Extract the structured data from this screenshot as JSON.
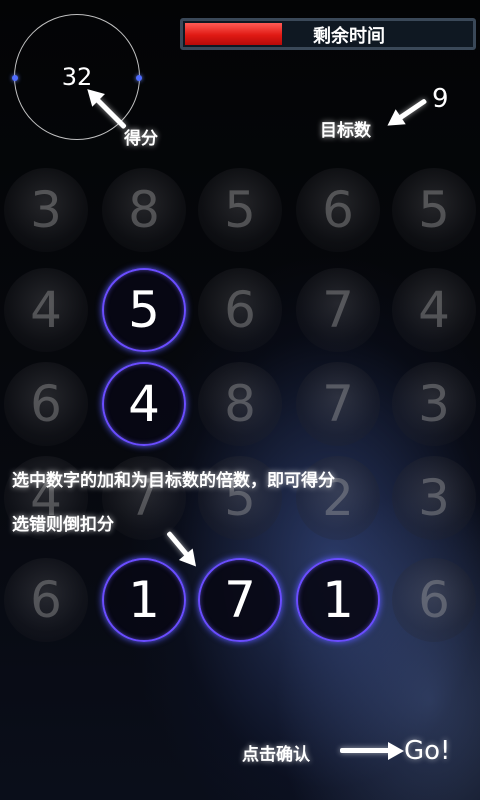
{
  "score": {
    "value": "32",
    "label": "得分"
  },
  "timer": {
    "label": "剩余时间",
    "remaining_fraction": 0.34
  },
  "target": {
    "value": "9",
    "label": "目标数"
  },
  "grid": {
    "rows": [
      [
        {
          "n": "3",
          "s": false
        },
        {
          "n": "8",
          "s": false
        },
        {
          "n": "5",
          "s": false
        },
        {
          "n": "6",
          "s": false
        },
        {
          "n": "5",
          "s": false
        }
      ],
      [
        {
          "n": "4",
          "s": false
        },
        {
          "n": "5",
          "s": true
        },
        {
          "n": "6",
          "s": false
        },
        {
          "n": "7",
          "s": false
        },
        {
          "n": "4",
          "s": false
        }
      ],
      [
        {
          "n": "6",
          "s": false
        },
        {
          "n": "4",
          "s": true
        },
        {
          "n": "8",
          "s": false
        },
        {
          "n": "7",
          "s": false
        },
        {
          "n": "3",
          "s": false
        }
      ],
      [
        {
          "n": "4",
          "s": false
        },
        {
          "n": "7",
          "s": false
        },
        {
          "n": "5",
          "s": false
        },
        {
          "n": "2",
          "s": false
        },
        {
          "n": "3",
          "s": false
        }
      ],
      [
        {
          "n": "6",
          "s": false
        },
        {
          "n": "1",
          "s": true
        },
        {
          "n": "7",
          "s": true
        },
        {
          "n": "1",
          "s": true
        },
        {
          "n": "6",
          "s": false
        }
      ]
    ]
  },
  "instructions": {
    "line1": "选中数字的加和为目标数的倍数，即可得分",
    "line2": "选错则倒扣分"
  },
  "confirm": {
    "label": "点击确认",
    "button": "Go!"
  },
  "colors": {
    "timer_fill": "#e8201a",
    "selection_ring": "#6a4dff"
  }
}
